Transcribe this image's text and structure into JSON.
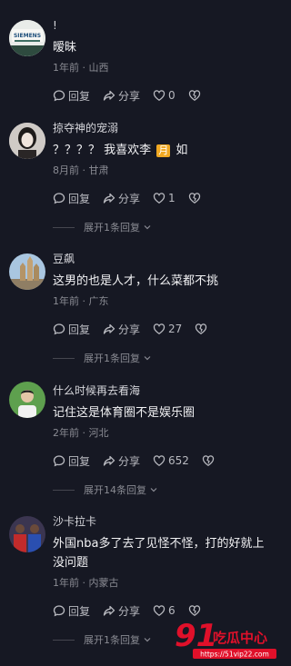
{
  "comments": [
    {
      "name": "!",
      "text": "暧昧",
      "meta": "1年前 · 山西",
      "reply": "回复",
      "share": "分享",
      "likes": "0",
      "avatar_text": "SIEMENS"
    },
    {
      "name": "掠夺神的宠溺",
      "text_before": "？？？？ 我喜欢李",
      "text_emoji": "月",
      "text_after": "如",
      "meta": "8月前 · 甘肃",
      "reply": "回复",
      "share": "分享",
      "likes": "1",
      "expand": "展开1条回复"
    },
    {
      "name": "豆飙",
      "text": "这男的也是人才，什么菜都不挑",
      "meta": "1年前 · 广东",
      "reply": "回复",
      "share": "分享",
      "likes": "27",
      "expand": "展开1条回复"
    },
    {
      "name": "什么时候再去看海",
      "text": "记住这是体育圈不是娱乐圈",
      "meta": "2年前 · 河北",
      "reply": "回复",
      "share": "分享",
      "likes": "652",
      "expand": "展开14条回复"
    },
    {
      "name": "沙卡拉卡",
      "text": "外国nba多了去了见怪不怪，打的好就上没问题",
      "meta": "1年前 · 内蒙古",
      "reply": "回复",
      "share": "分享",
      "likes": "6",
      "expand": "展开1条回复"
    }
  ],
  "watermark": {
    "logo_number": "91",
    "logo_text": "吃瓜中心",
    "url": "https://51vip22.com"
  },
  "colors": {
    "background": "#161823",
    "emoji_box": "#f0a822",
    "watermark_red": "#e0102a"
  }
}
